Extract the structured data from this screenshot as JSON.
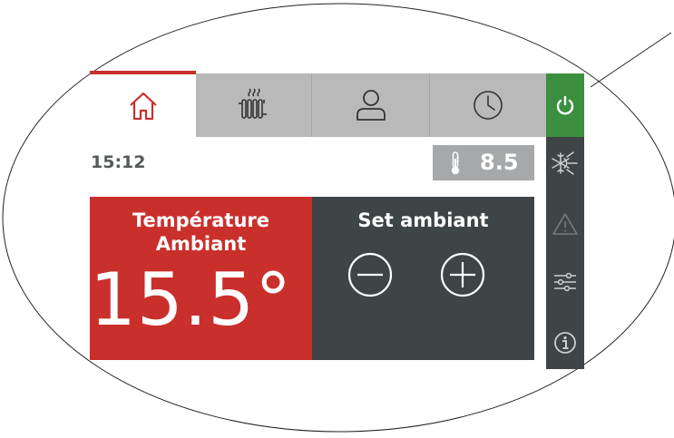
{
  "header": {
    "tabs": [
      {
        "name": "home",
        "icon": "home-icon",
        "active": true
      },
      {
        "name": "heating",
        "icon": "radiator-icon",
        "active": false
      },
      {
        "name": "user",
        "icon": "user-icon",
        "active": false
      },
      {
        "name": "schedule",
        "icon": "clock-icon",
        "active": false
      }
    ],
    "power_icon": "power-icon"
  },
  "status": {
    "time": "15:12",
    "outdoor_temp": "8.5",
    "outdoor_icon": "thermometer-icon"
  },
  "ambient_panel": {
    "title_line1": "Température",
    "title_line2": "Ambiant",
    "value": "15.5°"
  },
  "setpoint_panel": {
    "title": "Set ambiant",
    "decrease_icon": "minus-circle-icon",
    "increase_icon": "plus-circle-icon"
  },
  "sidebar": {
    "items": [
      {
        "name": "mode",
        "icon": "sun-snowflake-icon"
      },
      {
        "name": "alarms",
        "icon": "warning-icon"
      },
      {
        "name": "settings",
        "icon": "sliders-icon"
      },
      {
        "name": "info",
        "icon": "info-icon"
      }
    ]
  },
  "colors": {
    "accent_red": "#c9302c",
    "dark_panel": "#3f4446",
    "power_green": "#3c8f3f",
    "tab_gray": "#b9b9b9"
  }
}
